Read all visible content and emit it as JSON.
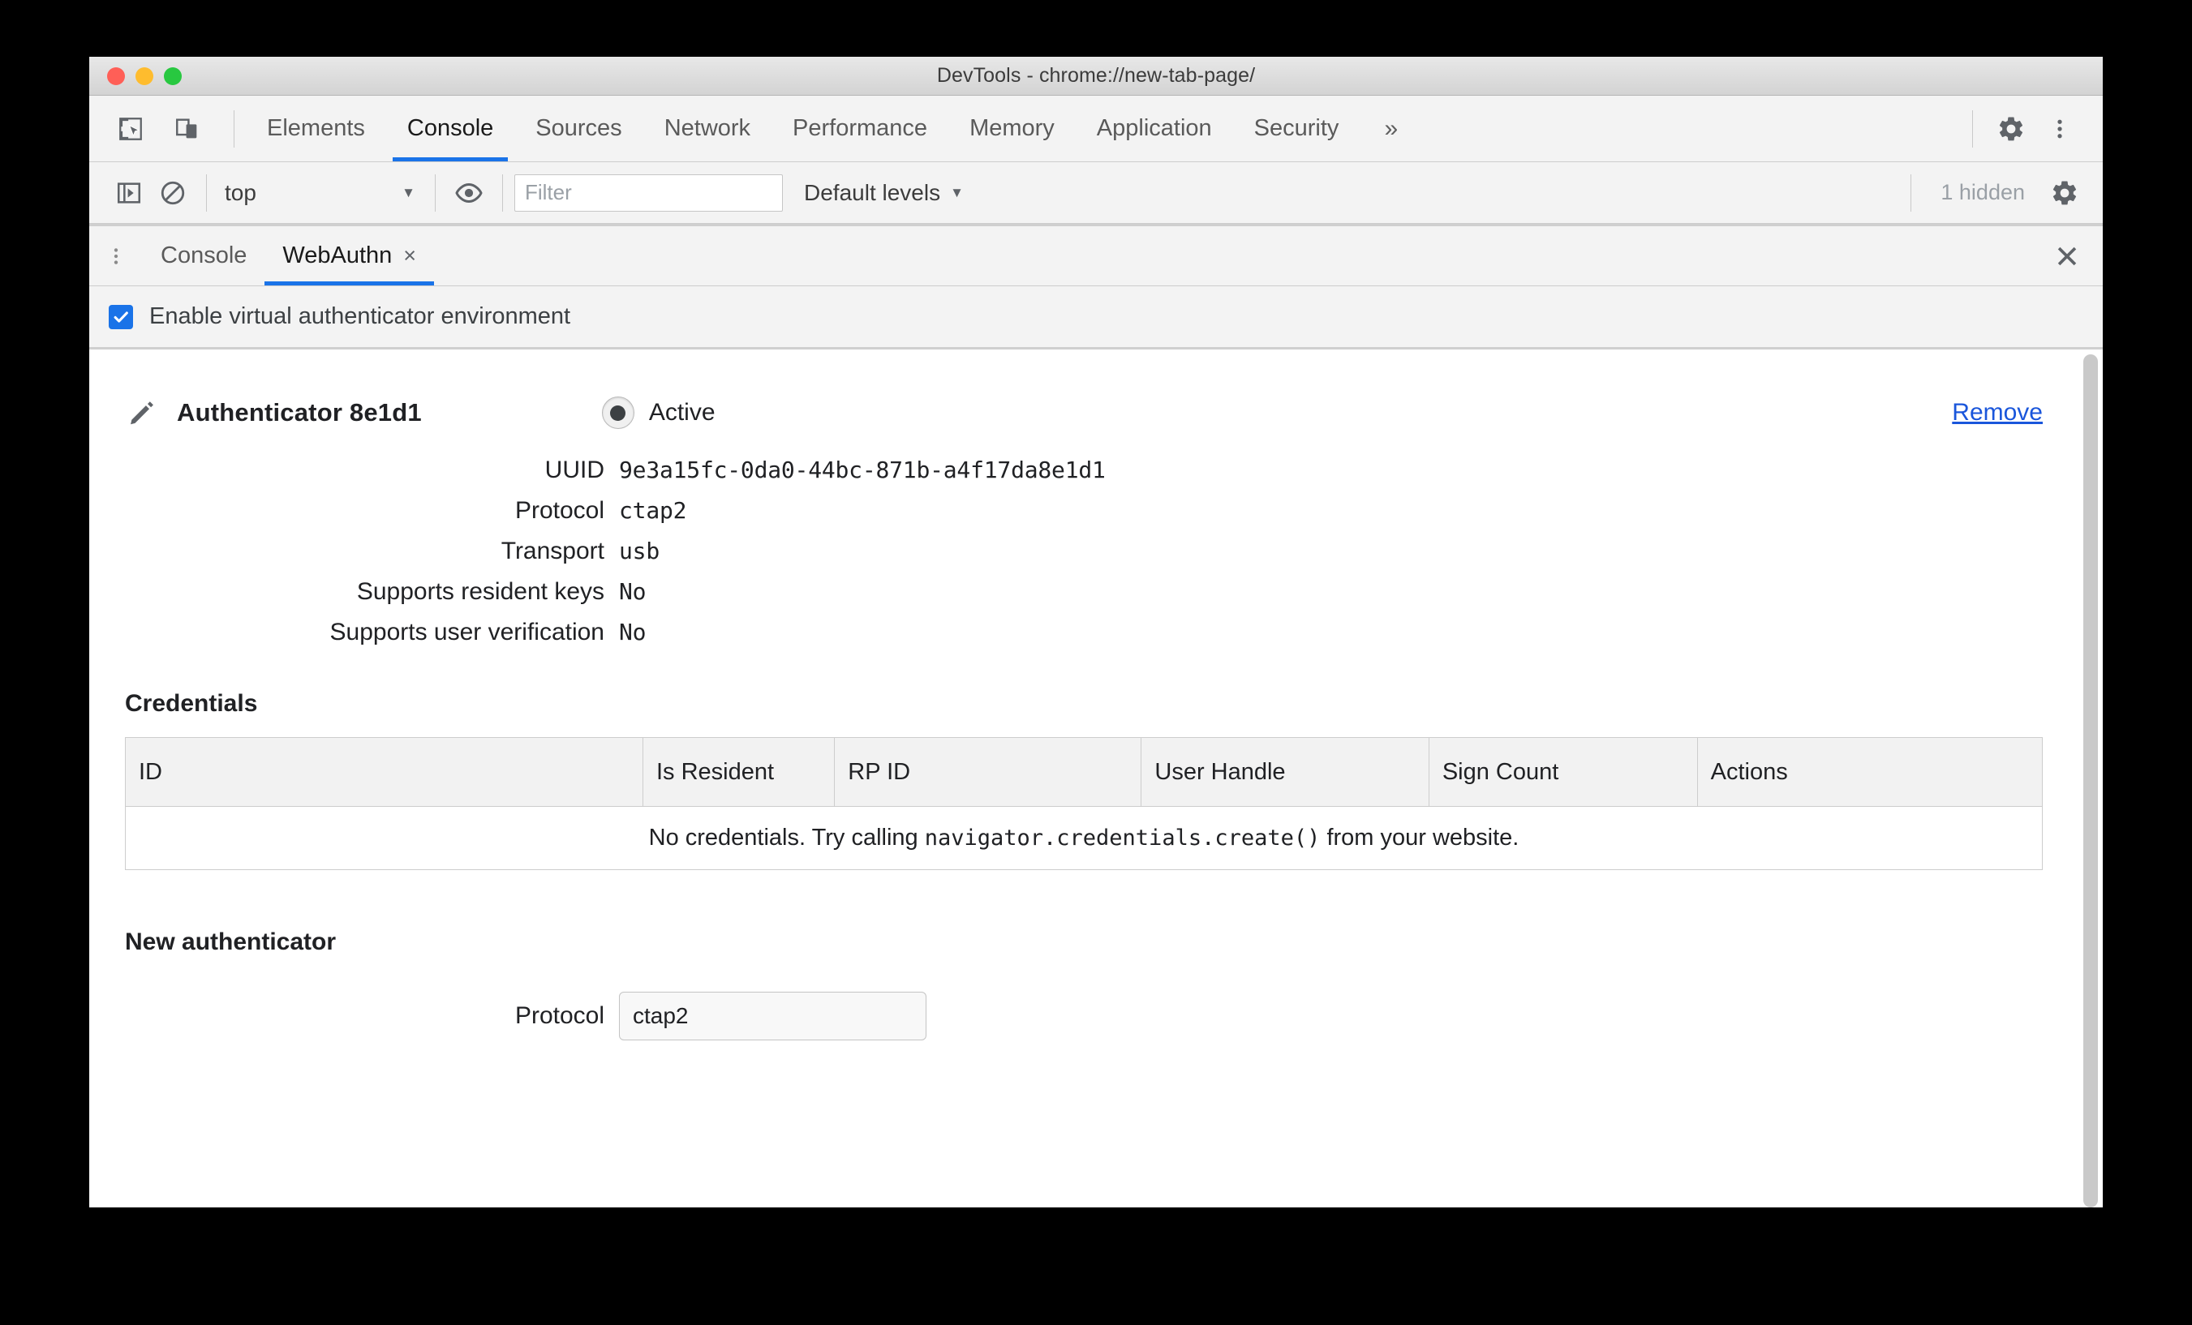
{
  "window": {
    "title": "DevTools - chrome://new-tab-page/",
    "traffic_lights": [
      "close",
      "minimize",
      "zoom"
    ]
  },
  "main_toolbar": {
    "inspect_icon": "inspect-element-icon",
    "device_icon": "device-toolbar-icon",
    "tabs": [
      {
        "label": "Elements",
        "active": false
      },
      {
        "label": "Console",
        "active": true
      },
      {
        "label": "Sources",
        "active": false
      },
      {
        "label": "Network",
        "active": false
      },
      {
        "label": "Performance",
        "active": false
      },
      {
        "label": "Memory",
        "active": false
      },
      {
        "label": "Application",
        "active": false
      },
      {
        "label": "Security",
        "active": false
      }
    ],
    "more_tabs": "»",
    "settings_icon": "gear-icon",
    "more_icon": "kebab-menu-icon"
  },
  "console_toolbar": {
    "sidebar_toggle_icon": "show-console-sidebar-icon",
    "clear_icon": "clear-console-icon",
    "context": "top",
    "context_caret": "▼",
    "eye_icon": "live-expression-icon",
    "filter_placeholder": "Filter",
    "filter_value": "",
    "levels_label": "Default levels",
    "levels_caret": "▼",
    "hidden_count": "1 hidden",
    "settings_icon": "console-settings-gear-icon"
  },
  "drawer": {
    "menu_icon": "drawer-more-options-icon",
    "tabs": [
      {
        "label": "Console",
        "active": false,
        "closable": false
      },
      {
        "label": "WebAuthn",
        "active": true,
        "closable": true,
        "close_glyph": "×"
      }
    ],
    "close_glyph": "✕"
  },
  "webauthn": {
    "enable_checkbox_label": "Enable virtual authenticator environment",
    "enable_checkbox_checked": true,
    "checkbox_color": "#1a73e8",
    "authenticator": {
      "edit_icon": "pencil-edit-icon",
      "title": "Authenticator 8e1d1",
      "status_label": "Active",
      "status_selected": true,
      "remove_label": "Remove",
      "remove_color": "#1a56db",
      "fields": [
        {
          "label": "UUID",
          "value": "9e3a15fc-0da0-44bc-871b-a4f17da8e1d1"
        },
        {
          "label": "Protocol",
          "value": "ctap2"
        },
        {
          "label": "Transport",
          "value": "usb"
        },
        {
          "label": "Supports resident keys",
          "value": "No"
        },
        {
          "label": "Supports user verification",
          "value": "No"
        }
      ]
    },
    "credentials": {
      "heading": "Credentials",
      "columns": [
        "ID",
        "Is Resident",
        "RP ID",
        "User Handle",
        "Sign Count",
        "Actions"
      ],
      "rows": [],
      "empty_prefix": "No credentials. Try calling ",
      "empty_code": "navigator.credentials.create()",
      "empty_suffix": " from your website."
    },
    "new_authenticator": {
      "heading": "New authenticator",
      "protocol_label": "Protocol",
      "protocol_value": "ctap2"
    }
  }
}
